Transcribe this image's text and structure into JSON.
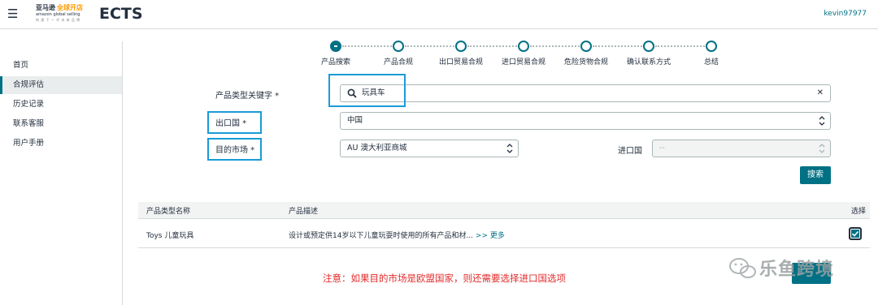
{
  "header": {
    "menu_icon": "hamburger-icon",
    "logo": {
      "line1_a": "亚马逊",
      "line1_b": "全球开店",
      "line2": "amazon global selling",
      "line3": "构 建 下 一 代 未 来 品 牌"
    },
    "app_title": "ECTS",
    "username": "kevin97977"
  },
  "sidebar": {
    "items": [
      {
        "label": "首页",
        "active": false
      },
      {
        "label": "合规评估",
        "active": true
      },
      {
        "label": "历史记录",
        "active": false
      },
      {
        "label": "联系客服",
        "active": false
      },
      {
        "label": "用户手册",
        "active": false
      }
    ]
  },
  "stepper": {
    "steps": [
      {
        "label": "产品搜索",
        "active": true
      },
      {
        "label": "产品合规",
        "active": false
      },
      {
        "label": "出口贸易合规",
        "active": false
      },
      {
        "label": "进口贸易合规",
        "active": false
      },
      {
        "label": "危险货物合规",
        "active": false
      },
      {
        "label": "确认联系方式",
        "active": false
      },
      {
        "label": "总结",
        "active": false
      }
    ]
  },
  "form": {
    "keyword_label": "产品类型关键字 *",
    "keyword_value": "玩具车",
    "export_label": "出口国 *",
    "export_value": "中国",
    "market_label": "目的市场 *",
    "market_value": "AU 澳大利亚商城",
    "import_label": "进口国",
    "import_value": "--",
    "search_button": "搜索"
  },
  "table": {
    "headers": {
      "type": "产品类型名称",
      "desc": "产品描述",
      "select": "选择"
    },
    "rows": [
      {
        "type": "Toys 儿童玩具",
        "desc": "设计或预定供14岁以下儿童玩耍时使用的所有产品和材...",
        "more": ">> 更多",
        "selected": true
      }
    ]
  },
  "notice": "注意：如果目的市场是欧盟国家，则还需要选择进口国选项",
  "watermark": "乐鱼跨境",
  "colors": {
    "accent": "#007185",
    "highlight": "#1a9bd7",
    "notice": "#e32b2b",
    "dark": "#232f3e"
  }
}
